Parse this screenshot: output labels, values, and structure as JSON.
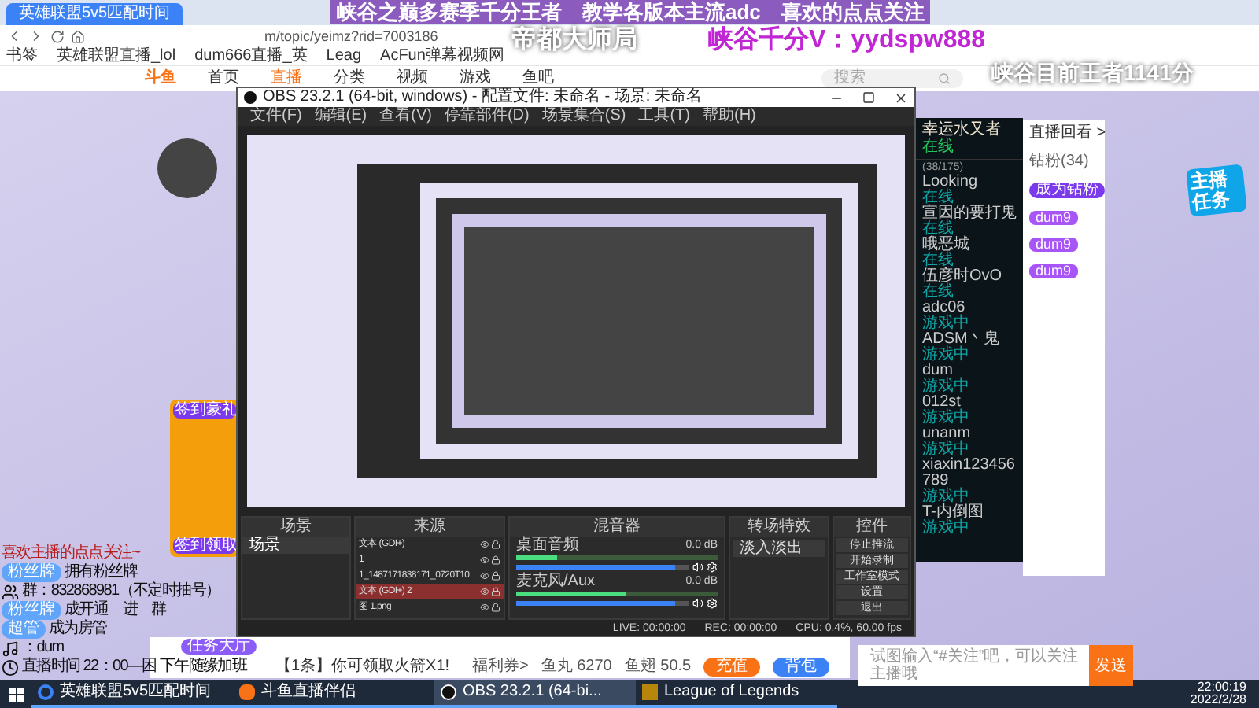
{
  "browser": {
    "tab": {
      "title": "英雄联盟5v5匹配时间",
      "selected": true
    },
    "url": "m/topic/yeimz?rid=7003186",
    "bookmarks": [
      "书签",
      "英雄联盟直播_lol",
      "dum666直播_英",
      "Leag",
      "AcFun弹幕视频网"
    ]
  },
  "site_nav": {
    "logo": "斗鱼",
    "items": [
      {
        "label": "首页",
        "selected": false
      },
      {
        "label": "直播",
        "selected": true
      },
      {
        "label": "分类",
        "selected": false
      },
      {
        "label": "视频",
        "selected": false
      },
      {
        "label": "游戏",
        "selected": false
      },
      {
        "label": "鱼吧",
        "selected": false
      }
    ],
    "search": {
      "placeholder": "搜索"
    }
  },
  "overlay": {
    "headline": "峡谷之巅多赛季千分王者　教学各版本主流adc　喜欢的点点关注",
    "subtitle": "帝都大师局",
    "contact": "峡谷千分V：yydspw888",
    "rank": "峡谷目前王者1141分",
    "task_sticker": "主播任务",
    "left_lines": [
      {
        "kind": "plain",
        "text": "喜欢主播的点点关注~"
      },
      {
        "kind": "badge",
        "badge": "粉丝牌",
        "text": "拥有粉丝牌"
      },
      {
        "kind": "qq",
        "text": "群：832868981（不定时抽号）"
      },
      {
        "kind": "badge",
        "badge": "粉丝牌",
        "text": "成开通　进　群"
      },
      {
        "kind": "badge",
        "badge": "超管",
        "text": "成为房管"
      },
      {
        "kind": "tiktok",
        "text": "：dum"
      },
      {
        "kind": "clock",
        "text": "直播时间 22：00—困 下午随缘加班"
      }
    ]
  },
  "obs": {
    "title": "OBS 23.2.1 (64-bit, windows) - 配置文件: 未命名 - 场景: 未命名",
    "menu": [
      "文件(F)",
      "编辑(E)",
      "查看(V)",
      "停靠部件(D)",
      "场景集合(S)",
      "工具(T)",
      "帮助(H)"
    ],
    "scenes": {
      "title": "场景",
      "items": [
        {
          "label": "场景",
          "selected": true
        }
      ]
    },
    "sources": {
      "title": "来源",
      "items": [
        {
          "label": "文本 (GDI+)",
          "selected": false
        },
        {
          "label": "1",
          "selected": false
        },
        {
          "label": "1_1487171838171_0720T10",
          "selected": false
        },
        {
          "label": "文本 (GDI+) 2",
          "selected": true
        },
        {
          "label": "图 1.png",
          "selected": false
        }
      ]
    },
    "mixer": {
      "title": "混音器",
      "channels": [
        {
          "name": "桌面音频",
          "reading": "0.0 dB",
          "level": 0.92,
          "meter": {
            "level": 0.2
          }
        },
        {
          "name": "麦克风/Aux",
          "reading": "0.0 dB",
          "level": 0.92,
          "meter": {
            "level": 0.55
          }
        }
      ]
    },
    "transitions": {
      "title": "转场特效",
      "value": "淡入淡出"
    },
    "controls": {
      "title": "控件",
      "buttons": [
        "停止推流",
        "开始录制",
        "工作室模式",
        "设置",
        "退出"
      ]
    },
    "status": [
      "LIVE: 00:00:00",
      "REC: 00:00:00",
      "CPU: 0.4%, 60.00 fps"
    ]
  },
  "friends": {
    "name": "幸运水又者",
    "status": "在线",
    "count": "(38/175)",
    "items": [
      {
        "name": "Looking",
        "status": "在线"
      },
      {
        "name": "宣因的要打鬼",
        "status": "在线"
      },
      {
        "name": "哦恶城",
        "status": "在线"
      },
      {
        "name": "伍彦时OvO",
        "status": "在线"
      },
      {
        "name": "adc06",
        "status": "游戏中"
      },
      {
        "name": "ADSM丶鬼",
        "status": "游戏中"
      },
      {
        "name": "dum",
        "status": "游戏中"
      },
      {
        "name": "012st",
        "status": "游戏中"
      },
      {
        "name": "unanm",
        "status": "游戏中"
      },
      {
        "name": "xiaxin123456789",
        "status": "游戏中"
      },
      {
        "name": "T-内倒图",
        "status": "游戏中"
      }
    ]
  },
  "chat": {
    "replay": "直播回看 >",
    "fans": "钻粉(34)",
    "join": "成为钻粉",
    "badges": [
      "dum9",
      "dum9",
      "dum9"
    ],
    "input": {
      "placeholder": "试图输入“#关注”吧，可以关注主播哦"
    },
    "send": "发送"
  },
  "room_bar": {
    "task": "任务大厅",
    "notice": "【1条】你可领取火箭X1!",
    "coupon": "福利券>",
    "fish": "鱼丸 6270",
    "fin": "鱼翅 50.5",
    "recharge": "充值",
    "bag": "背包",
    "signin": [
      "签到豪礼",
      "签到领取"
    ]
  },
  "taskbar": {
    "items": [
      {
        "label": "英雄联盟5v5匹配时间",
        "kind": "browser",
        "selected": false
      },
      {
        "label": "斗鱼直播伴侣",
        "kind": "douyu",
        "selected": false
      },
      {
        "label": "OBS 23.2.1 (64-bi...",
        "kind": "obs",
        "selected": true
      },
      {
        "label": "League of Legends",
        "kind": "lol",
        "selected": false
      }
    ],
    "time": "22:00:19",
    "date": "2022/2/28"
  }
}
